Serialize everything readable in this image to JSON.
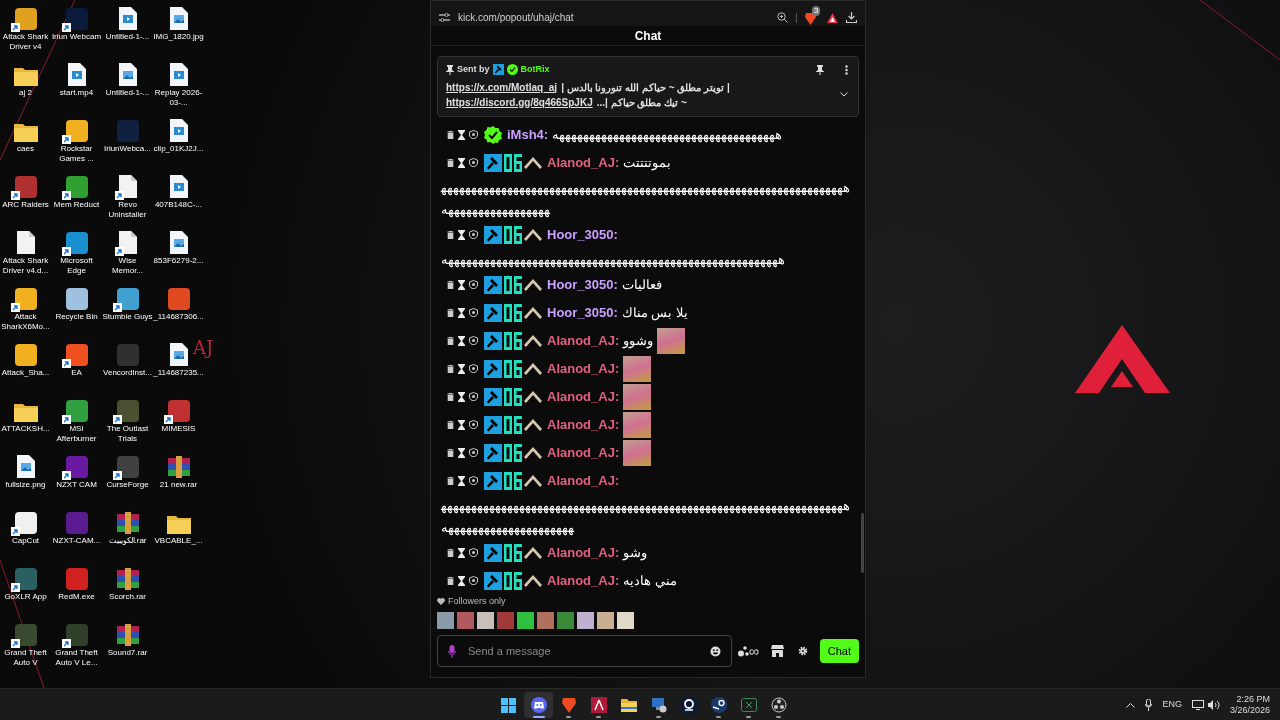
{
  "desktop": {
    "columns": [
      [
        {
          "label": "Attack Shark Driver v4",
          "kind": "app",
          "color": "#e0a020",
          "shortcut": true
        },
        {
          "label": "aj 2",
          "kind": "folder",
          "shortcut": false
        },
        {
          "label": "caes",
          "kind": "folder",
          "shortcut": false
        },
        {
          "label": "ARC Raiders",
          "kind": "app",
          "color": "#b03030",
          "shortcut": true
        },
        {
          "label": "Attack Shark Driver v4.d...",
          "kind": "doc",
          "shortcut": false
        },
        {
          "label": "Attack SharkX6Mo...",
          "kind": "app",
          "color": "#f0b020",
          "shortcut": true
        },
        {
          "label": "Attack_Sha...",
          "kind": "app",
          "color": "#f0b020",
          "shortcut": false
        },
        {
          "label": "ATTACKSH...",
          "kind": "folder",
          "shortcut": false
        },
        {
          "label": "fullsize.png",
          "kind": "image",
          "shortcut": false
        },
        {
          "label": "CapCut",
          "kind": "app",
          "color": "#f0f0f0",
          "shortcut": true
        },
        {
          "label": "GoXLR App",
          "kind": "app",
          "color": "#2a6060",
          "shortcut": true
        },
        {
          "label": "Grand Theft Auto V",
          "kind": "app",
          "color": "#3a4a30",
          "shortcut": true
        }
      ],
      [
        {
          "label": "Iriun Webcam",
          "kind": "app",
          "color": "#0a1a3a",
          "shortcut": true
        },
        {
          "label": "start.mp4",
          "kind": "video",
          "shortcut": false
        },
        {
          "label": "Rockstar Games ...",
          "kind": "app",
          "color": "#f0b020",
          "shortcut": true
        },
        {
          "label": "Mem Reduct",
          "kind": "app",
          "color": "#30a030",
          "shortcut": true
        },
        {
          "label": "Microsoft Edge",
          "kind": "app",
          "color": "#1a8fd0",
          "shortcut": true
        },
        {
          "label": "Recycle Bin",
          "kind": "app",
          "color": "#a0c0e0",
          "shortcut": false
        },
        {
          "label": "EA",
          "kind": "app",
          "color": "#f05020",
          "shortcut": true
        },
        {
          "label": "MSI Afterburner",
          "kind": "app",
          "color": "#30a040",
          "shortcut": true
        },
        {
          "label": "NZXT CAM",
          "kind": "app",
          "color": "#6a1aa0",
          "shortcut": true
        },
        {
          "label": "NZXT-CAM...",
          "kind": "app",
          "color": "#5a1a90",
          "shortcut": false
        },
        {
          "label": "RedM.exe",
          "kind": "app",
          "color": "#d02020",
          "shortcut": false
        },
        {
          "label": "Grand Theft Auto V Le...",
          "kind": "app",
          "color": "#2f3f2a",
          "shortcut": true
        }
      ],
      [
        {
          "label": "Untitled-1-...",
          "kind": "video",
          "shortcut": false
        },
        {
          "label": "Untitled-1-...",
          "kind": "image",
          "shortcut": false
        },
        {
          "label": "IriunWebca...",
          "kind": "app",
          "color": "#102040",
          "shortcut": false
        },
        {
          "label": "Revo Uninstaller",
          "kind": "doc",
          "shortcut": true
        },
        {
          "label": "Wise Memor...",
          "kind": "doc",
          "shortcut": true
        },
        {
          "label": "Stumble Guys",
          "kind": "app",
          "color": "#40a0d0",
          "shortcut": true
        },
        {
          "label": "VencordInst...",
          "kind": "app",
          "color": "#303030",
          "shortcut": false
        },
        {
          "label": "The Outlast Trials",
          "kind": "app",
          "color": "#4a5030",
          "shortcut": true
        },
        {
          "label": "CurseForge",
          "kind": "app",
          "color": "#404040",
          "shortcut": true
        },
        {
          "label": "الكويبيت.rar",
          "kind": "rar",
          "shortcut": false
        },
        {
          "label": "Scorch.rar",
          "kind": "rar",
          "shortcut": false
        },
        {
          "label": "Sound7.rar",
          "kind": "rar",
          "shortcut": false
        }
      ],
      [
        {
          "label": "IMG_1820.jpg",
          "kind": "image",
          "shortcut": false
        },
        {
          "label": "Replay 2026-03-...",
          "kind": "video",
          "shortcut": false
        },
        {
          "label": "clip_01KJ2J...",
          "kind": "video",
          "shortcut": false
        },
        {
          "label": "407B148C-...",
          "kind": "video",
          "shortcut": false
        },
        {
          "label": "853F6279-2...",
          "kind": "image",
          "shortcut": false
        },
        {
          "label": "_114687306...",
          "kind": "app",
          "color": "#e04a20",
          "shortcut": false
        },
        {
          "label": "_114687235...",
          "kind": "image",
          "shortcut": false
        },
        {
          "label": "MIMESIS",
          "kind": "app",
          "color": "#c03030",
          "shortcut": true
        },
        {
          "label": "21 new.rar",
          "kind": "rar",
          "shortcut": false
        },
        {
          "label": "VBCABLE_...",
          "kind": "folder",
          "shortcut": false
        }
      ]
    ],
    "wallpaper_text": "AJ"
  },
  "browser": {
    "url": "kick.com/popout/uhaj/chat",
    "shield_badge": "3"
  },
  "chat": {
    "title": "Chat",
    "pinned": {
      "sent_by": "Sent by",
      "author": "BotRix",
      "lines": [
        {
          "link": "https://x.com/Motlaq_aj",
          "text": "| تويتر مطلق ~ حياكم الله تنورونا بالدس |"
        },
        {
          "link": "https://discord.gg/8q466SpJKJ",
          "text": "~ تيك مطلق حياكم |..."
        }
      ]
    },
    "messages": [
      {
        "user": "iMsh4:",
        "color": "#c9a0ff",
        "verified": true,
        "text": "هههههههههههههههههههههههههههههههههههههه",
        "emote": false
      },
      {
        "user": "Alanod_AJ:",
        "color": "#e0607e",
        "moderator": true,
        "og": true,
        "rank": true,
        "text": "بموتتتتت",
        "overflow": "هههههههههههههههههههههههههههههههههههههههههههههههههههههههههههههههههههههههههههههههههههههه",
        "emote": false
      },
      {
        "user": "Hoor_3050:",
        "color": "#c9a0ff",
        "moderator": true,
        "og": true,
        "rank": true,
        "overflow": "ههههههههههههههههههههههههههههههههههههههههههههههههههههههههه",
        "emote": false
      },
      {
        "user": "Hoor_3050:",
        "color": "#c9a0ff",
        "moderator": true,
        "og": true,
        "rank": true,
        "text": "فعاليات",
        "emote": false
      },
      {
        "user": "Hoor_3050:",
        "color": "#c9a0ff",
        "moderator": true,
        "og": true,
        "rank": true,
        "text": "يلا بس مناك",
        "emote": false
      },
      {
        "user": "Alanod_AJ:",
        "color": "#e0607e",
        "moderator": true,
        "og": true,
        "rank": true,
        "text": "وشوو",
        "emote": true
      },
      {
        "user": "Alanod_AJ:",
        "color": "#e0607e",
        "moderator": true,
        "og": true,
        "rank": true,
        "emote": true
      },
      {
        "user": "Alanod_AJ:",
        "color": "#e0607e",
        "moderator": true,
        "og": true,
        "rank": true,
        "emote": true
      },
      {
        "user": "Alanod_AJ:",
        "color": "#e0607e",
        "moderator": true,
        "og": true,
        "rank": true,
        "emote": true
      },
      {
        "user": "Alanod_AJ:",
        "color": "#e0607e",
        "moderator": true,
        "og": true,
        "rank": true,
        "emote": true
      },
      {
        "user": "Alanod_AJ:",
        "color": "#e0607e",
        "moderator": true,
        "og": true,
        "rank": true,
        "overflow": "هههههههههههههههههههههههههههههههههههههههههههههههههههههههههههههههههههههههههههههههههههههههههه",
        "emote": false
      },
      {
        "user": "Alanod_AJ:",
        "color": "#e0607e",
        "moderator": true,
        "og": true,
        "rank": true,
        "text": "وشو",
        "emote": false
      },
      {
        "user": "Alanod_AJ:",
        "color": "#e0607e",
        "moderator": true,
        "og": true,
        "rank": true,
        "text": "مني هاديه",
        "emote": false
      }
    ],
    "mode": "Followers only",
    "recent_users": [
      {
        "color": "#8a9aa8"
      },
      {
        "color": "#b05a60"
      },
      {
        "color": "#c8c0b8"
      },
      {
        "color": "#a03a3a"
      },
      {
        "color": "#30c040"
      },
      {
        "color": "#b07060"
      },
      {
        "color": "#3a8a3a"
      },
      {
        "color": "#c0b0d0"
      },
      {
        "color": "#c8b090"
      },
      {
        "color": "#e0d8c8"
      }
    ],
    "input": {
      "placeholder": "Send a message"
    },
    "points": "∞",
    "send_button": "Chat"
  },
  "taskbar": {
    "apps": [
      {
        "kind": "start",
        "running": false,
        "selected": false
      },
      {
        "kind": "discord",
        "running": true,
        "selected": true
      },
      {
        "kind": "brave",
        "running": true,
        "selected": false
      },
      {
        "kind": "red-app",
        "running": true,
        "selected": false
      },
      {
        "kind": "explorer",
        "running": false,
        "selected": false
      },
      {
        "kind": "pc-app",
        "running": true,
        "selected": false
      },
      {
        "kind": "webcam",
        "running": false,
        "selected": false
      },
      {
        "kind": "steam",
        "running": true,
        "selected": false
      },
      {
        "kind": "xbox",
        "running": true,
        "selected": false
      },
      {
        "kind": "obs",
        "running": true,
        "selected": false
      }
    ],
    "language": "ENG",
    "time": "2:26 PM",
    "date": "3/26/2026"
  }
}
